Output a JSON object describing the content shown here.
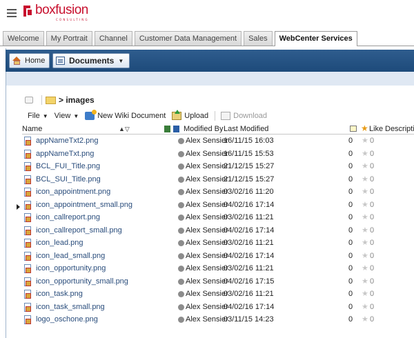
{
  "brand": {
    "name": "boxfusion",
    "tagline": "CONSULTING"
  },
  "nav_tabs": [
    {
      "label": "Welcome",
      "active": false
    },
    {
      "label": "My Portrait",
      "active": false
    },
    {
      "label": "Channel",
      "active": false
    },
    {
      "label": "Customer Data Management",
      "active": false
    },
    {
      "label": "Sales",
      "active": false
    },
    {
      "label": "WebCenter Services",
      "active": true
    }
  ],
  "header": {
    "home_label": "Home",
    "documents_label": "Documents"
  },
  "breadcrumb": {
    "path": "> images"
  },
  "toolbar": {
    "file_label": "File",
    "view_label": "View",
    "new_wiki_label": "New Wiki Document",
    "upload_label": "Upload",
    "download_label": "Download"
  },
  "table": {
    "headers": {
      "name": "Name",
      "modified_by": "Modified By",
      "last_modified": "Last Modified",
      "like": "Like",
      "description": "Description"
    },
    "rows": [
      {
        "name": "appNameTxt2.png",
        "user": "Alex Sensier",
        "modified": "16/11/15 16:03",
        "comments": "0",
        "likes": "0"
      },
      {
        "name": "appNameTxt.png",
        "user": "Alex Sensier",
        "modified": "16/11/15 15:53",
        "comments": "0",
        "likes": "0"
      },
      {
        "name": "BCL_FUI_Title.png",
        "user": "Alex Sensier",
        "modified": "21/12/15 15:27",
        "comments": "0",
        "likes": "0"
      },
      {
        "name": "BCL_SUI_Title.png",
        "user": "Alex Sensier",
        "modified": "21/12/15 15:27",
        "comments": "0",
        "likes": "0"
      },
      {
        "name": "icon_appointment.png",
        "user": "Alex Sensier",
        "modified": "03/02/16 11:20",
        "comments": "0",
        "likes": "0"
      },
      {
        "name": "icon_appointment_small.png",
        "user": "Alex Sensier",
        "modified": "04/02/16 17:14",
        "comments": "0",
        "likes": "0"
      },
      {
        "name": "icon_callreport.png",
        "user": "Alex Sensier",
        "modified": "03/02/16 11:21",
        "comments": "0",
        "likes": "0"
      },
      {
        "name": "icon_callreport_small.png",
        "user": "Alex Sensier",
        "modified": "04/02/16 17:14",
        "comments": "0",
        "likes": "0"
      },
      {
        "name": "icon_lead.png",
        "user": "Alex Sensier",
        "modified": "03/02/16 11:21",
        "comments": "0",
        "likes": "0"
      },
      {
        "name": "icon_lead_small.png",
        "user": "Alex Sensier",
        "modified": "04/02/16 17:14",
        "comments": "0",
        "likes": "0"
      },
      {
        "name": "icon_opportunity.png",
        "user": "Alex Sensier",
        "modified": "03/02/16 11:21",
        "comments": "0",
        "likes": "0"
      },
      {
        "name": "icon_opportunity_small.png",
        "user": "Alex Sensier",
        "modified": "04/02/16 17:15",
        "comments": "0",
        "likes": "0"
      },
      {
        "name": "icon_task.png",
        "user": "Alex Sensier",
        "modified": "03/02/16 11:21",
        "comments": "0",
        "likes": "0"
      },
      {
        "name": "icon_task_small.png",
        "user": "Alex Sensier",
        "modified": "04/02/16 17:14",
        "comments": "0",
        "likes": "0"
      },
      {
        "name": "logo_oschone.png",
        "user": "Alex Sensier",
        "modified": "03/11/15 14:23",
        "comments": "0",
        "likes": "0"
      }
    ]
  }
}
